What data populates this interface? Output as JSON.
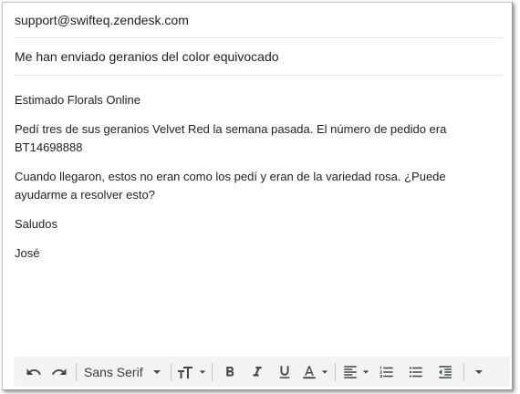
{
  "compose": {
    "to": "support@swifteq.zendesk.com",
    "subject": "Me han enviado geranios del color equivocado",
    "body": {
      "greeting": "Estimado Florals Online",
      "paragraph1": "Pedí tres de sus geranios Velvet Red la semana pasada. El número de pedido era BT14698888",
      "paragraph2": "Cuando llegaron, estos no eran como los pedí y eran de la variedad rosa. ¿Puede ayudarme a resolver esto?",
      "closing": "Saludos",
      "signature": "José"
    }
  },
  "toolbar": {
    "font_family": "Sans Serif",
    "icons": [
      "undo-icon",
      "redo-icon",
      "font-size-icon",
      "bold-icon",
      "italic-icon",
      "underline-icon",
      "text-color-icon",
      "align-icon",
      "numbered-list-icon",
      "bulleted-list-icon",
      "indent-less-icon",
      "more-options-icon"
    ]
  },
  "colors": {
    "toolbar_background": "#f1f3f4",
    "text": "#222222",
    "icon": "#444746"
  }
}
